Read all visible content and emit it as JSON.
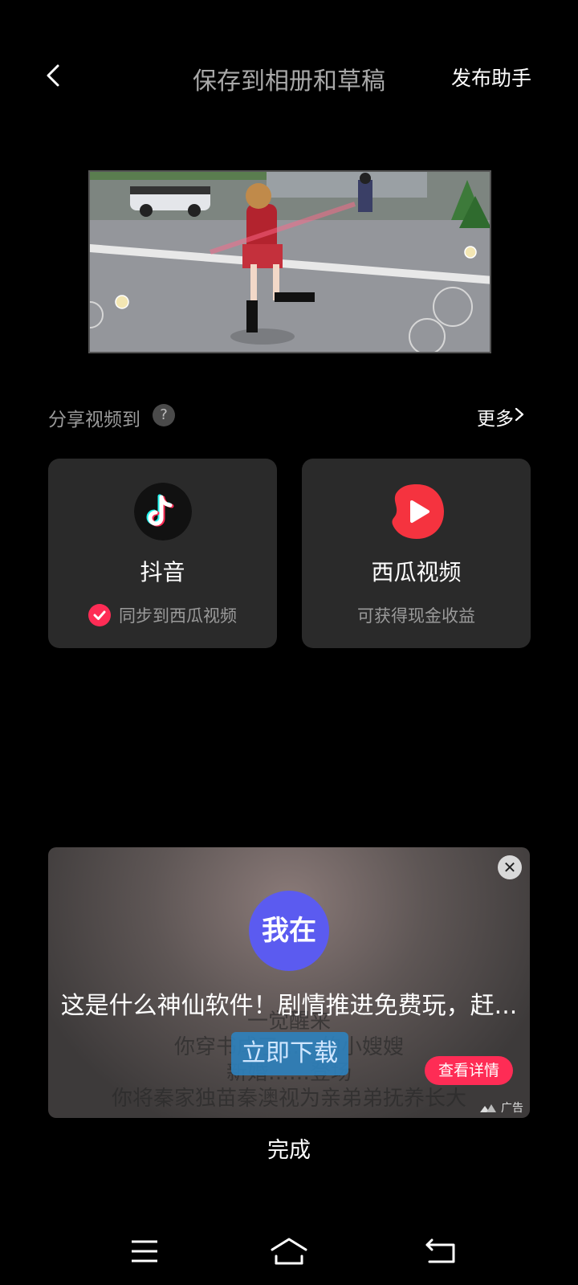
{
  "header": {
    "title": "保存到相册和草稿",
    "right_action": "发布助手"
  },
  "share": {
    "label": "分享视频到",
    "help_icon": "?",
    "more_label": "更多"
  },
  "targets": [
    {
      "name": "抖音",
      "sub": "同步到西瓜视频",
      "checked": true
    },
    {
      "name": "西瓜视频",
      "sub": "可获得现金收益"
    }
  ],
  "ad": {
    "logo_text": "我在",
    "headline": "这是什么神仙软件！剧情推进免费玩，赶...",
    "background_lines": [
      "一觉醒来",
      "你穿书成了……的小嫂嫂",
      "新婚……登场",
      "你将秦家独苗秦澳视为亲弟弟抚养长大"
    ],
    "download_label": "立即下载",
    "detail_label": "查看详情",
    "tag": "广告",
    "close_icon": "✕"
  },
  "done_label": "完成",
  "colors": {
    "accent": "#fe2c55",
    "card_bg": "#2a2a2a",
    "xigua_red": "#f5333f"
  }
}
